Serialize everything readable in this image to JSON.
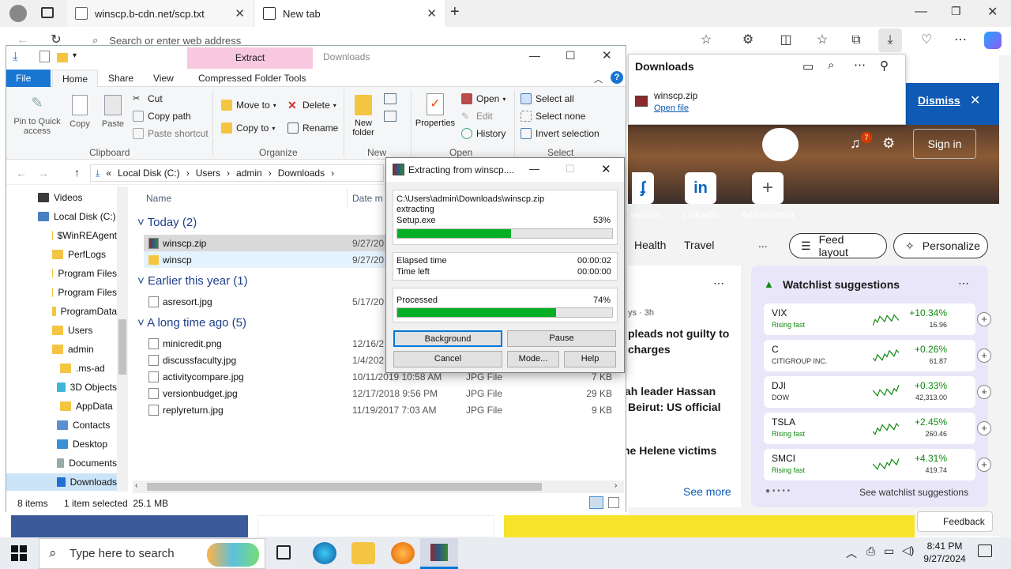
{
  "browser": {
    "tabs": [
      {
        "label": "winscp.b-cdn.net/scp.txt"
      },
      {
        "label": "New tab"
      }
    ],
    "address_placeholder": "Search or enter web address"
  },
  "downloads_panel": {
    "title": "Downloads",
    "file": "winscp.zip",
    "open_link": "Open file"
  },
  "newtab": {
    "dismiss": "Dismiss",
    "sign_in": "Sign in",
    "notif_count": "7",
    "shortcuts": [
      {
        "label": "Lessons"
      },
      {
        "label": "LinkedIn",
        "icon": "in"
      },
      {
        "label": "Add shortcut",
        "icon": "+"
      }
    ],
    "categories": [
      "Health",
      "Travel",
      "..."
    ],
    "feed_layout": "Feed layout",
    "personalize": "Personalize",
    "news": [
      "ys · 3h",
      "pleads not guilty to",
      "charges",
      "ah leader Hassan",
      "Beirut: US official",
      "he Helene victims"
    ],
    "see_more": "See more",
    "watchlist": {
      "title": "Watchlist suggestions",
      "rows": [
        {
          "sym": "VIX",
          "sub": "Rising fast",
          "chg": "+10.34%",
          "price": "16.96"
        },
        {
          "sym": "C",
          "sub": "CITIGROUP INC.",
          "chg": "+0.26%",
          "price": "61.87"
        },
        {
          "sym": "DJI",
          "sub": "DOW",
          "chg": "+0.33%",
          "price": "42,313.00"
        },
        {
          "sym": "TSLA",
          "sub": "Rising fast",
          "chg": "+2.45%",
          "price": "260.46"
        },
        {
          "sym": "SMCI",
          "sub": "Rising fast",
          "chg": "+4.31%",
          "price": "419.74"
        }
      ],
      "see": "See watchlist suggestions"
    },
    "feedback": "Feedback"
  },
  "explorer": {
    "title": "Downloads",
    "context_tab": "Extract",
    "ribbon_tabs": [
      "File",
      "Home",
      "Share",
      "View",
      "Compressed Folder Tools"
    ],
    "clipboard": {
      "pin": "Pin to Quick access",
      "copy": "Copy",
      "paste": "Paste",
      "cut": "Cut",
      "copy_path": "Copy path",
      "paste_shortcut": "Paste shortcut",
      "group": "Clipboard"
    },
    "organize": {
      "move": "Move to",
      "copy": "Copy to",
      "delete": "Delete",
      "rename": "Rename",
      "group": "Organize"
    },
    "new": {
      "folder": "New folder",
      "group": "New"
    },
    "open": {
      "properties": "Properties",
      "open": "Open",
      "edit": "Edit",
      "history": "History",
      "group": "Open"
    },
    "select": {
      "all": "Select all",
      "none": "Select none",
      "invert": "Invert selection",
      "group": "Select"
    },
    "path": [
      "Local Disk (C:)",
      "Users",
      "admin",
      "Downloads"
    ],
    "nav": [
      {
        "label": "Videos"
      },
      {
        "label": "Local Disk (C:)"
      },
      {
        "label": "$WinREAgent"
      },
      {
        "label": "PerfLogs"
      },
      {
        "label": "Program Files"
      },
      {
        "label": "Program Files"
      },
      {
        "label": "ProgramData"
      },
      {
        "label": "Users"
      },
      {
        "label": "admin"
      },
      {
        "label": ".ms-ad"
      },
      {
        "label": "3D Objects"
      },
      {
        "label": "AppData"
      },
      {
        "label": "Contacts"
      },
      {
        "label": "Desktop"
      },
      {
        "label": "Documents"
      },
      {
        "label": "Downloads"
      }
    ],
    "columns": {
      "name": "Name",
      "date": "Date m"
    },
    "groups": {
      "today": "Today (2)",
      "year": "Earlier this year (1)",
      "long": "A long time ago (5)"
    },
    "files": [
      {
        "name": "winscp.zip",
        "date": "9/27/20",
        "type": "",
        "size": ""
      },
      {
        "name": "winscp",
        "date": "9/27/20",
        "type": "",
        "size": ""
      },
      {
        "name": "asresort.jpg",
        "date": "5/17/20",
        "type": "",
        "size": ""
      },
      {
        "name": "minicredit.png",
        "date": "12/16/2",
        "type": "",
        "size": ""
      },
      {
        "name": "discussfaculty.jpg",
        "date": "1/4/202",
        "type": "",
        "size": ""
      },
      {
        "name": "activitycompare.jpg",
        "date": "10/11/2019 10:58 AM",
        "type": "JPG File",
        "size": "7 KB"
      },
      {
        "name": "versionbudget.jpg",
        "date": "12/17/2018 9:56 PM",
        "type": "JPG File",
        "size": "29 KB"
      },
      {
        "name": "replyreturn.jpg",
        "date": "11/19/2017 7:03 AM",
        "type": "JPG File",
        "size": "9 KB"
      }
    ],
    "status": {
      "items": "8 items",
      "selected": "1 item selected  25.1 MB"
    }
  },
  "extract": {
    "title": "Extracting from winscp....",
    "path": "C:\\Users\\admin\\Downloads\\winscp.zip",
    "action": "extracting",
    "file": "Setup.exe",
    "file_pct_label": "53%",
    "file_pct": 0.53,
    "elapsed_label": "Elapsed time",
    "elapsed": "00:00:02",
    "left_label": "Time left",
    "left": "00:00:00",
    "processed_label": "Processed",
    "processed_pct_label": "74%",
    "processed_pct": 0.74,
    "buttons": {
      "background": "Background",
      "pause": "Pause",
      "cancel": "Cancel",
      "mode": "Mode...",
      "help": "Help"
    }
  },
  "taskbar": {
    "search": "Type here to search",
    "time": "8:41 PM",
    "date": "9/27/2024"
  },
  "colors": {
    "progress": "#06b025",
    "accent": "#0f5ab4"
  }
}
